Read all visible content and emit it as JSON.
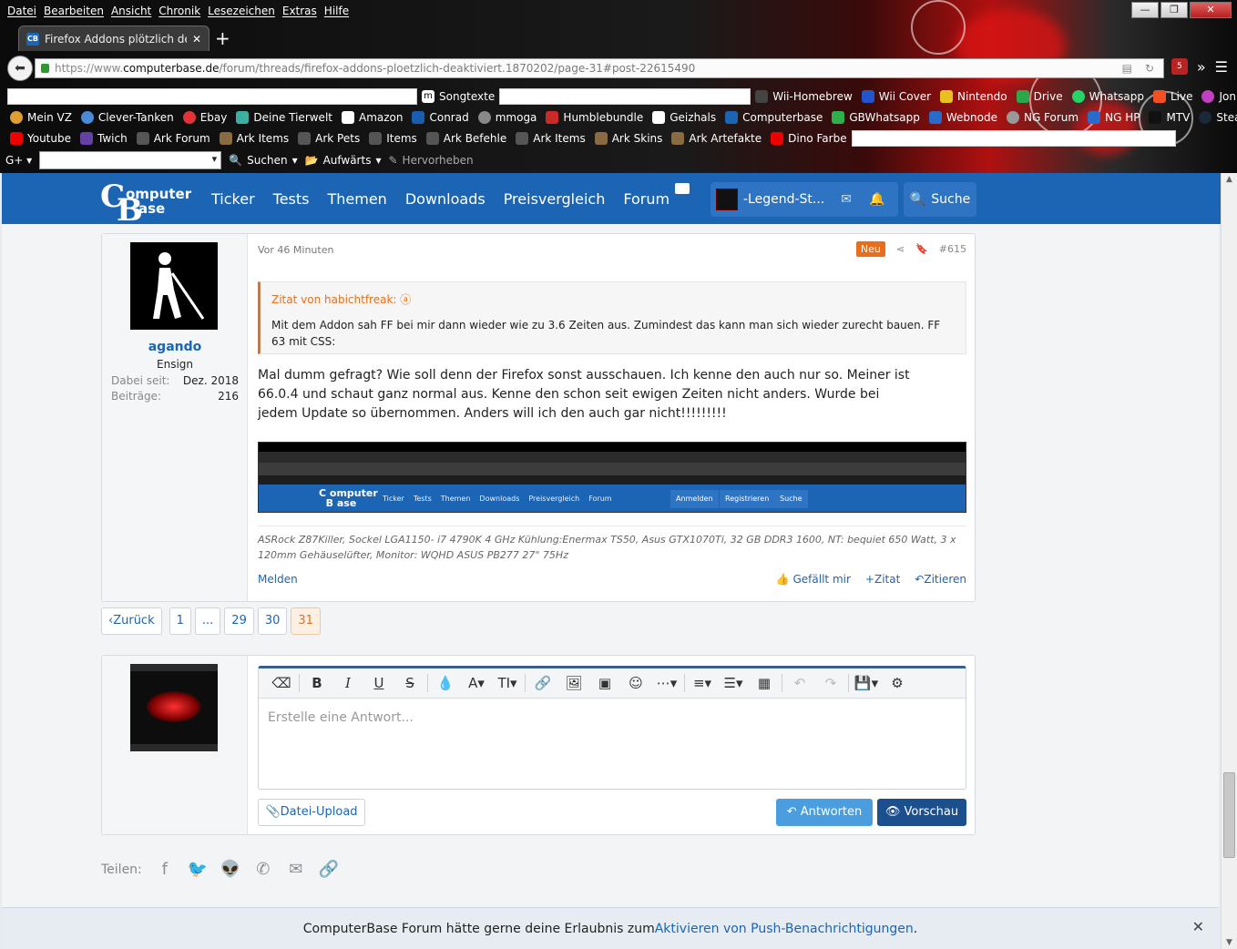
{
  "browser": {
    "menu": [
      "Datei",
      "Bearbeiten",
      "Ansicht",
      "Chronik",
      "Lesezeichen",
      "Extras",
      "Hilfe"
    ],
    "tab_title": "Firefox Addons plötzlich deakt",
    "url_prefix": "https://www.",
    "url_domain": "computerbase.de",
    "url_path": "/forum/threads/firefox-addons-ploetzlich-deaktiviert.1870202/page-31#post-22615490",
    "ub_badge": "5",
    "bookmarks_row1": [
      "Songtexte",
      "Wii-Homebrew",
      "Wii Cover",
      "Nintendo",
      "Drive",
      "Whatsapp",
      "Live",
      "Jonline"
    ],
    "bookmarks_row2": [
      "Mein VZ",
      "Clever-Tanken",
      "Ebay",
      "Deine Tierwelt",
      "Amazon",
      "Conrad",
      "mmoga",
      "Humblebundle",
      "Geizhals",
      "Computerbase",
      "GBWhatsapp",
      "Webnode",
      "NG Forum",
      "NG HP",
      "MTV",
      "Steam Forum"
    ],
    "bookmarks_row3": [
      "Youtube",
      "Twich",
      "Ark Forum",
      "Ark Items",
      "Ark Pets",
      "Items",
      "Ark Befehle",
      "Ark Items",
      "Ark Skins",
      "Ark Artefakte",
      "Dino Farbe"
    ],
    "tools": {
      "search": "Suchen",
      "up": "Aufwärts",
      "highlight": "Hervorheben"
    }
  },
  "site": {
    "logo_line1": "omputer",
    "logo_line2": "ase",
    "nav": [
      "Ticker",
      "Tests",
      "Themen",
      "Downloads",
      "Preisvergleich",
      "Forum"
    ],
    "username": "-Legend-St...",
    "search_label": "Suche"
  },
  "post": {
    "time": "Vor 46 Minuten",
    "badge_new": "Neu",
    "number": "#615",
    "author": "agando",
    "rank": "Ensign",
    "stats": [
      {
        "label": "Dabei seit:",
        "value": "Dez. 2018"
      },
      {
        "label": "Beiträge:",
        "value": "216"
      }
    ],
    "quote_header": "Zitat von habichtfreak: ⓐ",
    "quote_text": "Mit dem Addon sah FF bei mir dann wieder wie zu 3.6 Zeiten aus. Zumindest das kann man sich wieder zurecht bauen. FF 63 mit CSS:",
    "body": "Mal dumm gefragt? Wie soll denn der Firefox sonst ausschauen. Ich kenne den auch nur so. Meiner ist 66.0.4 und schaut ganz normal aus. Kenne den schon seit ewigen Zeiten nicht anders. Wurde bei jedem Update so übernommen. Anders will ich den auch gar nicht!!!!!!!!!",
    "screenshot_nav": [
      "Ticker",
      "Tests",
      "Themen",
      "Downloads",
      "Preisvergleich",
      "Forum"
    ],
    "screenshot_buttons": [
      "Anmelden",
      "Registrieren",
      "Suche"
    ],
    "signature": "ASRock Z87Killer, Sockel LGA1150- i7 4790K 4 GHz Kühlung:Enermax TS50, Asus GTX1070Ti, 32 GB DDR3 1600, NT: bequiet 650 Watt, 3 x 120mm Gehäuselüfter, Monitor: WQHD ASUS PB277 27\" 75Hz",
    "report": "Melden",
    "actions": [
      "Gefällt mir",
      "Zitat",
      "Zitieren"
    ]
  },
  "pagination": [
    "‹Zurück",
    "1",
    "...",
    "29",
    "30",
    "31"
  ],
  "reply": {
    "placeholder": "Erstelle eine Antwort...",
    "upload": "Datei-Upload",
    "send": "Antworten",
    "preview": "Vorschau"
  },
  "share": {
    "label": "Teilen:"
  },
  "push": {
    "text": "ComputerBase Forum hätte gerne deine Erlaubnis zum ",
    "link": "Aktivieren von Push-Benachrichtigungen",
    "end": "."
  }
}
